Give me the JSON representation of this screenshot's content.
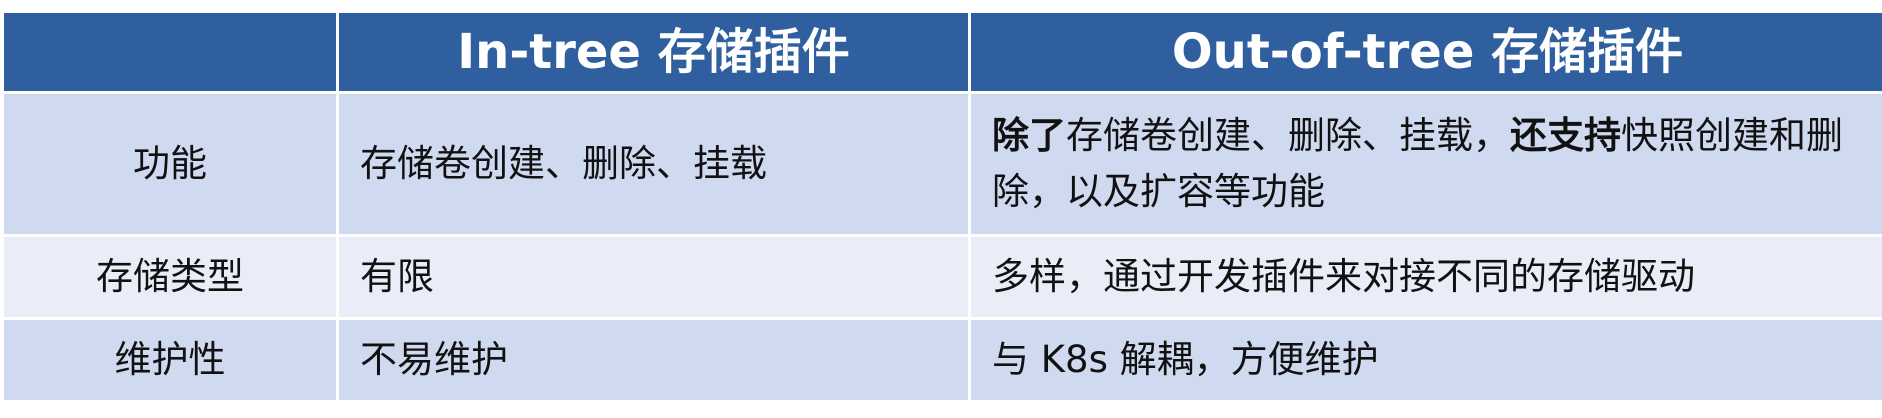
{
  "headers": {
    "empty": "",
    "intree": "In-tree 存储插件",
    "outtree": "Out-of-tree 存储插件"
  },
  "rows": [
    {
      "label": "功能",
      "intree": "存储卷创建、删除、挂载",
      "outtree_parts": {
        "b1": "除了",
        "t1": "存储卷创建、删除、挂载，",
        "b2": "还支持",
        "t2": "快照创建和删除，以及扩容等功能"
      }
    },
    {
      "label": "存储类型",
      "intree": "有限",
      "outtree": "多样，通过开发插件来对接不同的存储驱动"
    },
    {
      "label": "维护性",
      "intree": "不易维护",
      "outtree": "与 K8s 解耦，方便维护"
    }
  ],
  "colors": {
    "header_bg": "#2f5f9f",
    "row_dark": "#cfd9ef",
    "row_light": "#e8edf7"
  }
}
